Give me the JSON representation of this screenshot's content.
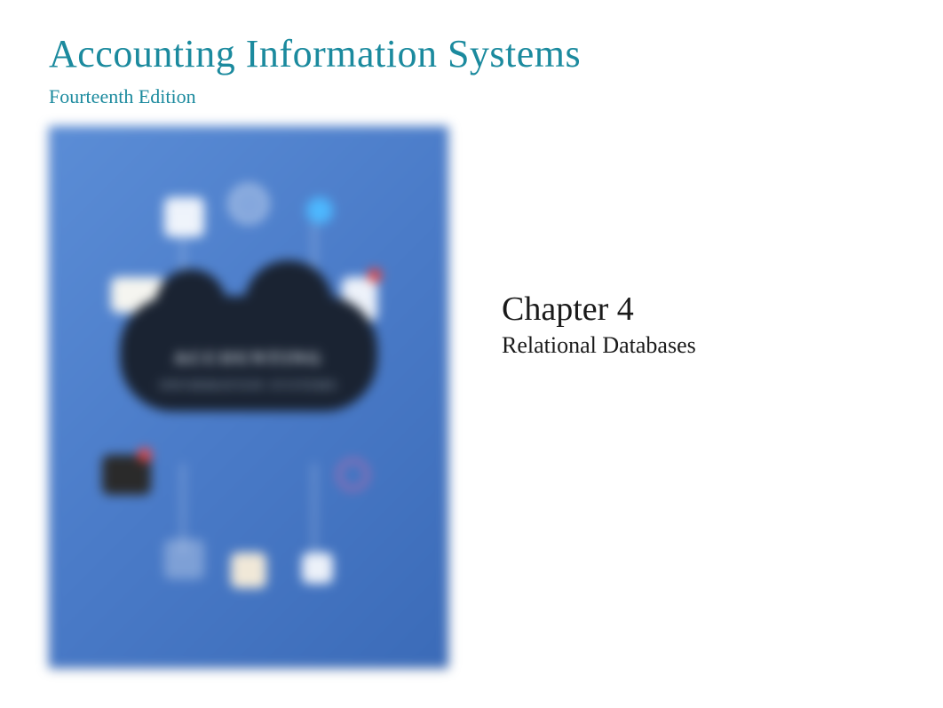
{
  "header": {
    "book_title": "Accounting Information Systems",
    "edition": "Fourteenth Edition"
  },
  "cover": {
    "title_line_1": "ACCOUNTING",
    "title_line_2": "INFORMATION SYSTEMS"
  },
  "chapter": {
    "number": "Chapter 4",
    "title": "Relational Databases"
  }
}
